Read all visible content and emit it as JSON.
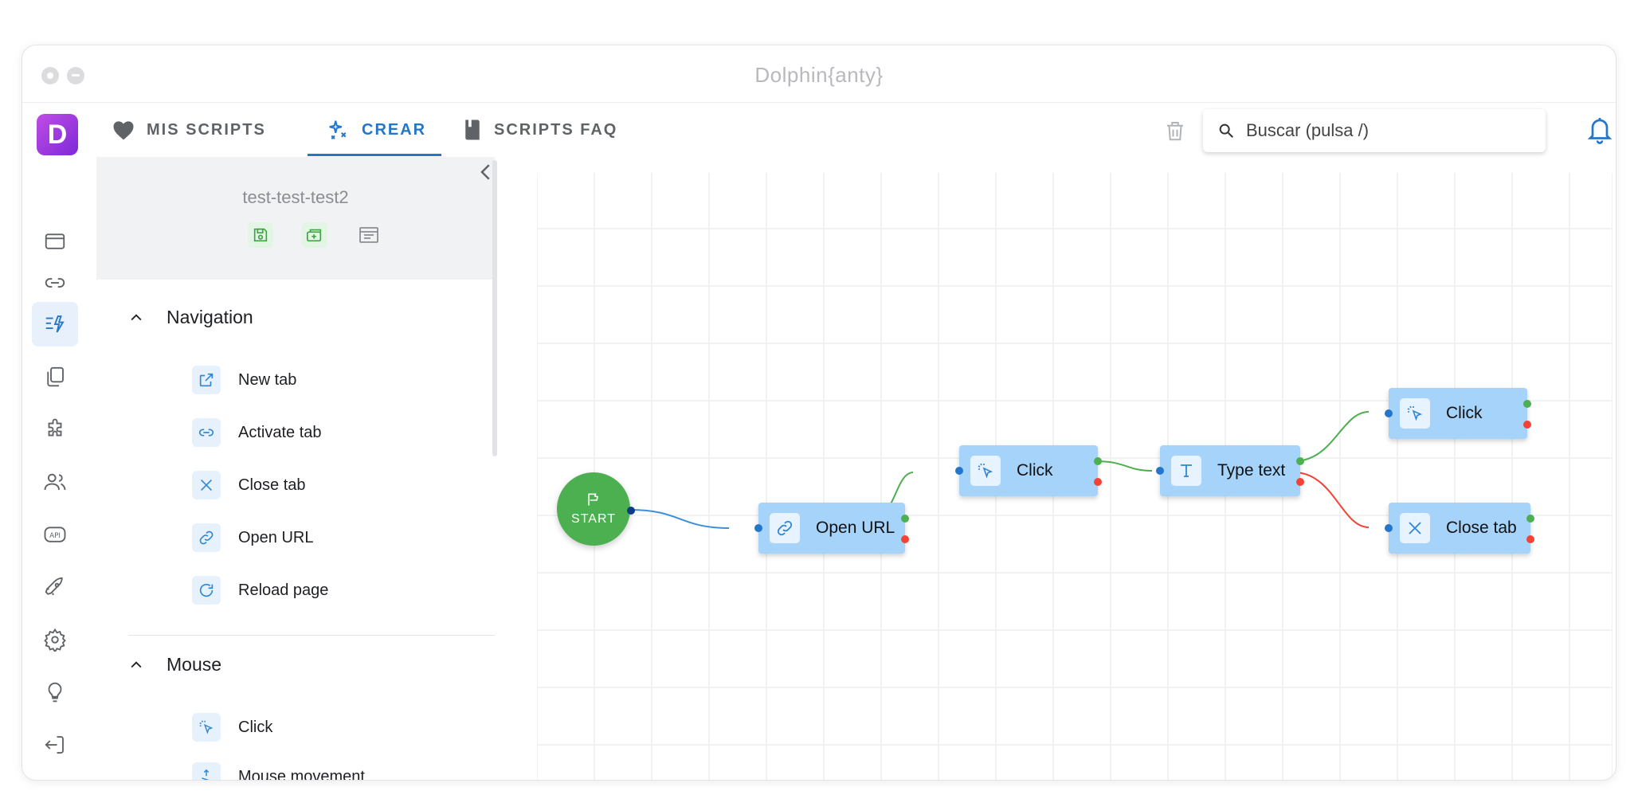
{
  "window": {
    "title": "Dolphin{anty}"
  },
  "brand": {
    "logo_letter": "D"
  },
  "rail": [
    "browser-icon",
    "link-icon",
    "scripts-icon",
    "copy-icon",
    "puzzle-icon",
    "users-icon",
    "api-icon",
    "rocket-icon",
    "gear-icon",
    "bulb-icon",
    "logout-icon"
  ],
  "rail_api_text": "API",
  "tabs": [
    {
      "label": "MIS SCRIPTS",
      "icon": "heart-icon"
    },
    {
      "label": "CREAR",
      "icon": "sparkles-icon"
    },
    {
      "label": "SCRIPTS FAQ",
      "icon": "book-icon"
    }
  ],
  "search": {
    "placeholder": "Buscar (pulsa /)"
  },
  "panel": {
    "script_name": "test-test-test2",
    "sections": [
      {
        "title": "Navigation",
        "items": [
          {
            "label": "New tab",
            "icon": "external-link-icon"
          },
          {
            "label": "Activate tab",
            "icon": "link-icon"
          },
          {
            "label": "Close tab",
            "icon": "close-icon"
          },
          {
            "label": "Open URL",
            "icon": "chain-icon"
          },
          {
            "label": "Reload page",
            "icon": "reload-icon"
          }
        ]
      },
      {
        "title": "Mouse",
        "items": [
          {
            "label": "Click",
            "icon": "cursor-click-icon"
          },
          {
            "label": "Mouse movement",
            "icon": "mouse-move-icon"
          }
        ]
      }
    ]
  },
  "canvas": {
    "start_label": "START",
    "nodes": {
      "open_url": "Open URL",
      "click1": "Click",
      "type_text": "Type text",
      "click2": "Click",
      "close_tab": "Close tab"
    }
  },
  "colors": {
    "accent": "#2376c9",
    "node": "#a5d3fa",
    "start": "#4caf50",
    "success": "#4caf50",
    "error": "#f44336",
    "link": "#3f8fd8"
  }
}
